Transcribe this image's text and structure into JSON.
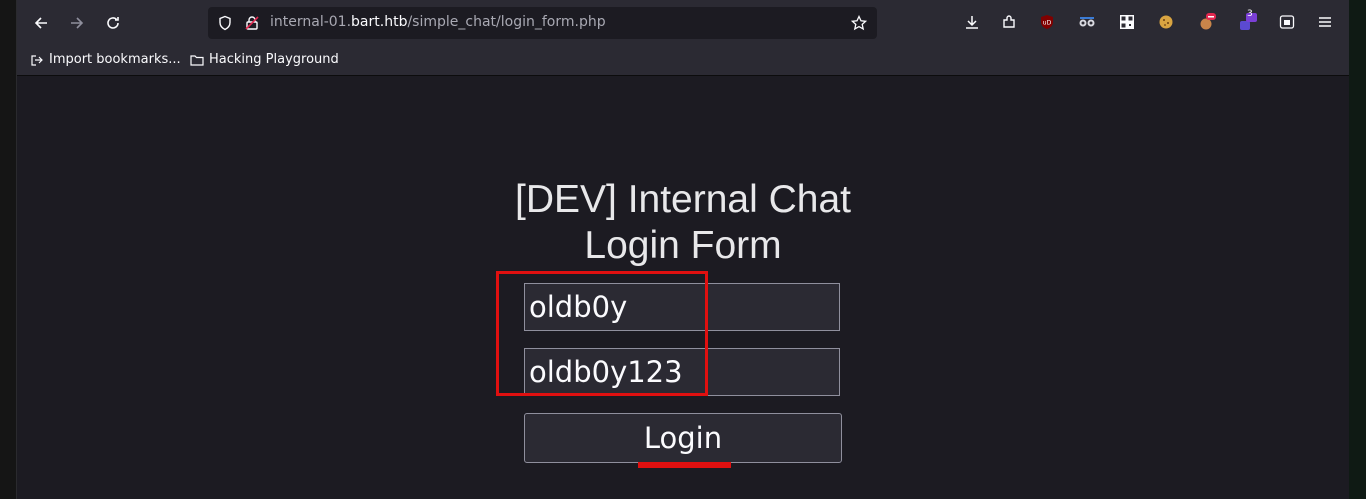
{
  "toolbar": {
    "back_icon": "arrow-left-icon",
    "forward_icon": "arrow-right-icon",
    "reload_icon": "reload-icon",
    "url_prefix": "internal-01.",
    "url_host": "bart.htb",
    "url_path": "/simple_chat/login_form.php",
    "extension_badge_count": "3"
  },
  "bookmarks": {
    "items": [
      {
        "label": "Import bookmarks...",
        "icon": "import-icon"
      },
      {
        "label": "Hacking Playground",
        "icon": "folder-icon"
      }
    ]
  },
  "page": {
    "title_line1": "[DEV] Internal Chat",
    "title_line2": "Login Form",
    "username_value": "oldb0y",
    "password_value": "oldb0y123",
    "login_label": "Login"
  },
  "colors": {
    "accent_red": "#e01010",
    "background": "#1c1b22"
  }
}
